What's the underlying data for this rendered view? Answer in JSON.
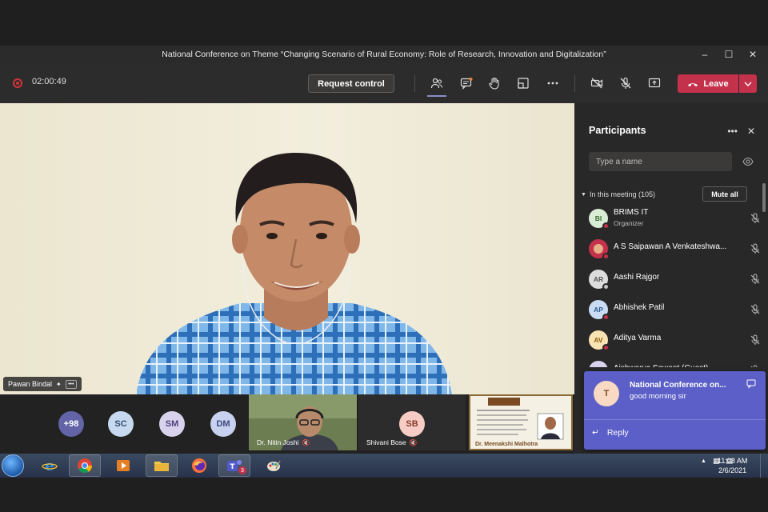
{
  "window": {
    "title": "National Conference on Theme “Changing Scenario of Rural Economy: Role of Research, Innovation and Digitalization”",
    "controls": [
      "–",
      "☐",
      "✕"
    ]
  },
  "toolbar": {
    "timer": "02:00:49",
    "request_control": "Request control",
    "leave": "Leave",
    "icons": [
      "participants-icon",
      "chat-icon",
      "raise-hand-icon",
      "rooms-icon",
      "more-icon",
      "camera-off-icon",
      "mic-off-icon",
      "share-icon"
    ]
  },
  "stage": {
    "speaker_name": "Pawan Bindal"
  },
  "strip": {
    "overflow_count": "+98",
    "avatars": [
      "SC",
      "SM",
      "DM"
    ],
    "tiles": [
      {
        "name": "Dr. Nitin Joshi"
      },
      {
        "name": "Shivani Bose",
        "initials": "SB"
      }
    ],
    "slide_caption": "Dr. Meenakshi Malhotra"
  },
  "participants": {
    "title": "Participants",
    "search_placeholder": "Type a name",
    "section": "In this meeting (105)",
    "mute_all": "Mute all",
    "items": [
      {
        "initials": "BI",
        "name": "BRIMS IT",
        "sub": "Organizer",
        "color": "#d9ecd5",
        "text_color": "#3b6a33"
      },
      {
        "initials": "",
        "name": "A S Saipawan A Venkateshwa...",
        "sub": "",
        "color": "#c4314b",
        "text_color": "#ffffff"
      },
      {
        "initials": "AR",
        "name": "Aashi Rajgor",
        "sub": "",
        "color": "#dcdcdc",
        "text_color": "#555555"
      },
      {
        "initials": "AP",
        "name": "Abhishek Patil",
        "sub": "",
        "color": "#c9dcf3",
        "text_color": "#2f5c8f"
      },
      {
        "initials": "AV",
        "name": "Aditya Varma",
        "sub": "",
        "color": "#f8e3b3",
        "text_color": "#8a5a08"
      },
      {
        "initials": "AS",
        "name": "Aishwarya Sawant (Guest)",
        "sub": "",
        "color": "#d9d2ec",
        "text_color": "#4e3f7c"
      }
    ]
  },
  "toast": {
    "initials": "T",
    "title": "National Conference on...",
    "message": "good morning sir",
    "reply": "Reply"
  },
  "taskbar": {
    "apps": [
      "internet-explorer",
      "chrome",
      "media-player",
      "file-explorer",
      "firefox",
      "teams",
      "paint"
    ],
    "teams_badge": "3",
    "time": "11:08 AM",
    "date": "2/6/2021"
  }
}
